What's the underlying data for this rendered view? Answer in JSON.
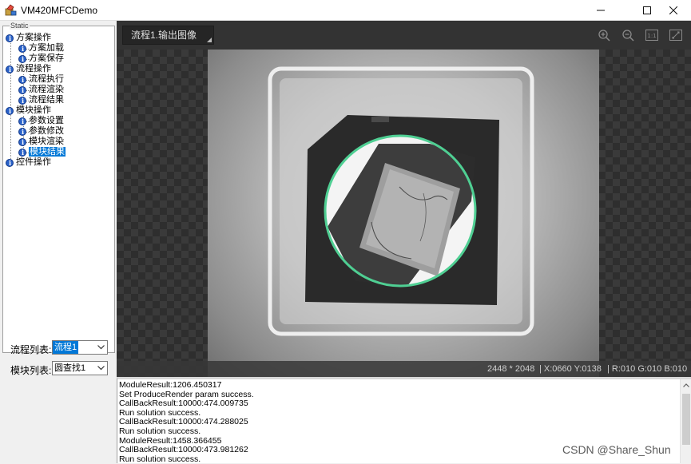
{
  "window": {
    "title": "VM420MFCDemo",
    "minimize_glyph": "—",
    "maximize_glyph": "☐",
    "close_glyph": "✕"
  },
  "left_panel": {
    "groupbox_caption": "Static",
    "tree": [
      {
        "label": "方案操作",
        "level": 0
      },
      {
        "label": "方案加载",
        "level": 1
      },
      {
        "label": "方案保存",
        "level": 1
      },
      {
        "label": "流程操作",
        "level": 0
      },
      {
        "label": "流程执行",
        "level": 1
      },
      {
        "label": "流程渲染",
        "level": 1
      },
      {
        "label": "流程结果",
        "level": 1
      },
      {
        "label": "模块操作",
        "level": 0
      },
      {
        "label": "参数设置",
        "level": 1
      },
      {
        "label": "参数修改",
        "level": 1
      },
      {
        "label": "模块渲染",
        "level": 1
      },
      {
        "label": "模块结果",
        "level": 1,
        "selected": true
      },
      {
        "label": "控件操作",
        "level": 0
      }
    ],
    "process_list": {
      "label": "流程列表:",
      "value": "流程1"
    },
    "module_list": {
      "label": "模块列表:",
      "value": "圆查找1"
    }
  },
  "viewer": {
    "tab_label": "流程1.输出图像",
    "tools": [
      "zoom-in-icon",
      "zoom-out-icon",
      "actual-size-icon",
      "fit-window-icon"
    ],
    "actual_size_text": "1:1",
    "status": {
      "resolution": "2448 * 2048",
      "coords": "| X:0660  Y:0138",
      "rgb": "| R:010  G:010  B:010"
    },
    "circle_color": "#4fcf93"
  },
  "log": {
    "lines": [
      "ModuleResult:1206.450317",
      "Set ProduceRender param success.",
      "CallBackResult:10000:474.009735",
      "Run solution success.",
      "CallBackResult:10000:474.288025",
      "Run solution success.",
      "ModuleResult:1458.366455",
      "CallBackResult:10000:473.981262",
      "Run solution success."
    ]
  },
  "watermark": "CSDN @Share_Shun"
}
